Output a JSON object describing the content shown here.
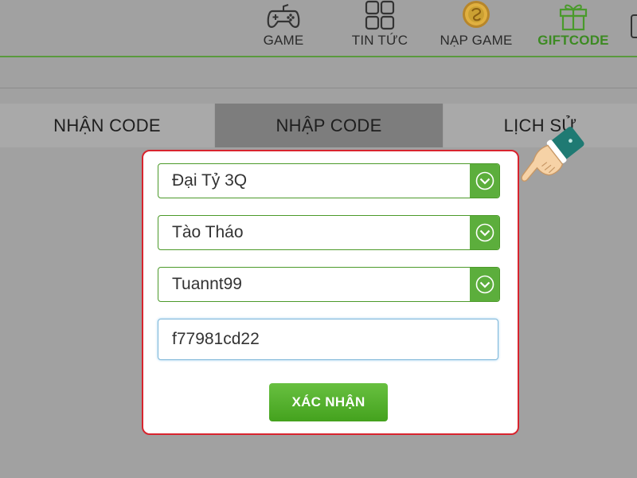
{
  "nav": {
    "items": [
      {
        "label": "GAME",
        "icon": "gamepad-icon"
      },
      {
        "label": "TIN TỨC",
        "icon": "grid-icon"
      },
      {
        "label": "NẠP GAME",
        "icon": "coin-icon"
      },
      {
        "label": "GIFTCODE",
        "icon": "gift-icon",
        "active": true
      }
    ]
  },
  "tabs": {
    "items": [
      {
        "label": "NHẬN CODE"
      },
      {
        "label": "NHẬP CODE",
        "active": true
      },
      {
        "label": "LỊCH SỬ"
      }
    ]
  },
  "form": {
    "server": "Đại Tỷ 3Q",
    "character": "Tào Tháo",
    "account": "Tuannt99",
    "code": "f77981cd22",
    "submit_label": "XÁC NHẬN"
  },
  "colors": {
    "accent_green": "#5cae3c",
    "panel_border_red": "#d8242e",
    "active_tab": "#7d7d7d",
    "background": "#a1a1a1"
  }
}
